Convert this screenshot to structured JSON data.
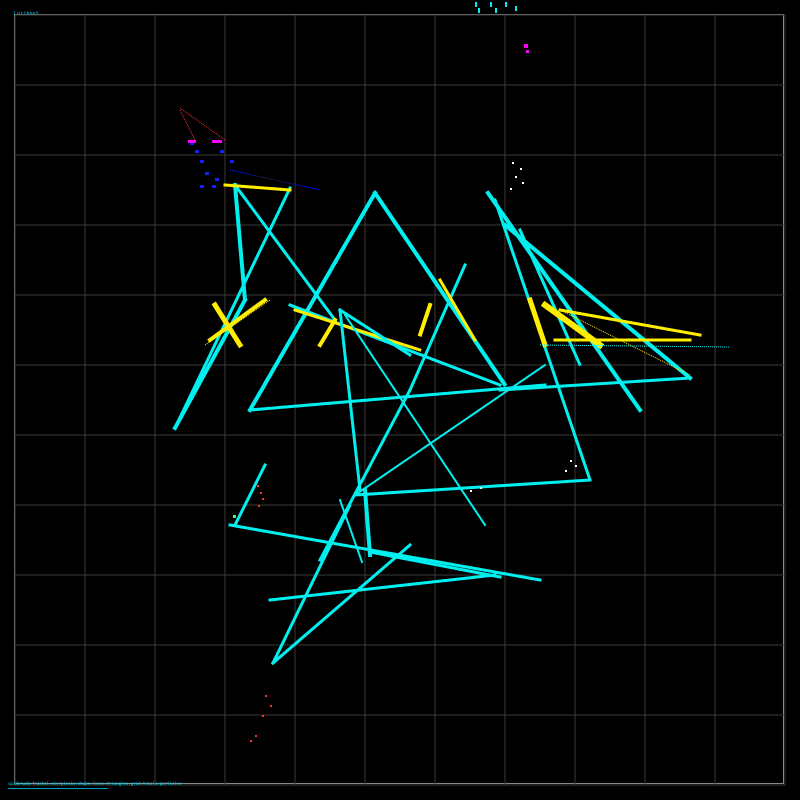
{
  "canvas": {
    "title": "Lorikeet",
    "status": "spiderweb+fractal+sierpinski+shape+lines+triangles+grid+trails+particles",
    "grid_color": "#3a3a3a",
    "frame_color": "#8a8a8a"
  },
  "palette": {
    "cyan": "#00f0f0",
    "yellow": "#ffee00",
    "blue": "#1020ff",
    "magenta": "#ff00ff",
    "red": "#ff3030",
    "white": "#ffffff"
  }
}
